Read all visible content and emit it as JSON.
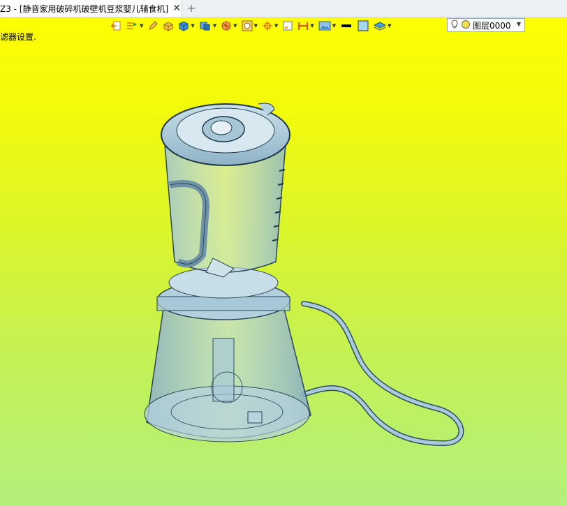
{
  "tab": {
    "title": "Z3 - [静音家用破碎机破壁机豆浆婴儿辅食机]",
    "close_glyph": "✕",
    "new_glyph": "+"
  },
  "status": {
    "text": "滤器设置."
  },
  "toolbar": {
    "icons": [
      "exit-icon",
      "layers-icon",
      "pen-icon",
      "box-yellow-icon",
      "cube-blue-icon",
      "cube-view-icon",
      "sphere-icon",
      "circle-view-icon",
      "crosshair-icon",
      "small-square-icon",
      "dimension-icon",
      "image-icon",
      "line-color-icon",
      "fill-color-icon",
      "layer-stack-icon"
    ],
    "line_color": "#000000",
    "fill_color": "#a8d8f0"
  },
  "layer": {
    "name": "图层0000"
  },
  "colors": {
    "bg_top": "#ffff00",
    "bg_bottom": "#b3f07b",
    "model": "#8fb8d0"
  }
}
